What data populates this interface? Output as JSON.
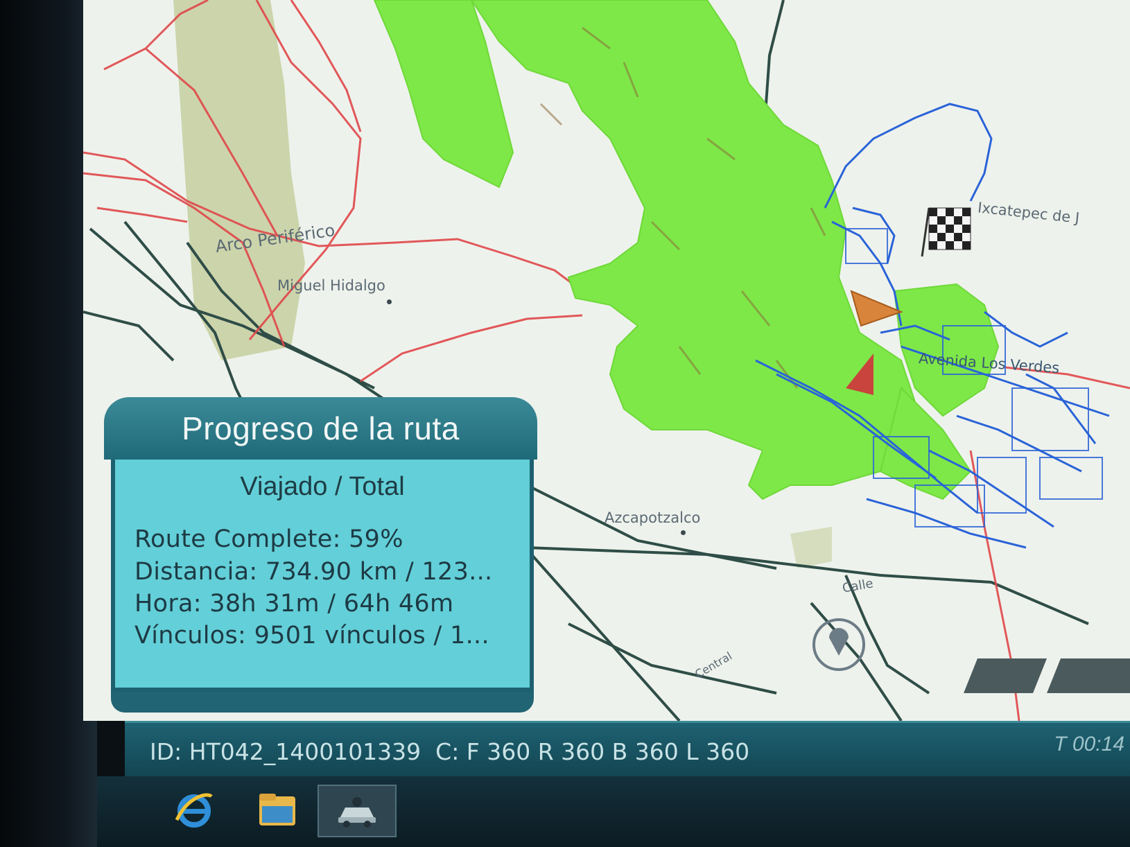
{
  "map": {
    "labels": {
      "arco_periferico": "Arco Periférico",
      "miguel_hidalgo": "Miguel Hidalgo",
      "azcapotzalco": "Azcapotzalco",
      "ixcatepec": "Ixcatepec de J",
      "avenida": "Avenida Los Verdes",
      "calle": "Calle",
      "central": "Central"
    },
    "colors": {
      "traveled_route": "#7ee848",
      "remaining_route": "#2a63d8",
      "highway": "#e0474a",
      "road": "#2f4d47",
      "park": "#c6cfa0"
    }
  },
  "route_panel": {
    "title": "Progreso de la ruta",
    "subtitle": "Viajado / Total",
    "route_complete": "Route Complete: 59%",
    "distance": "Distancia: 734.90 km / 123...",
    "time": "Hora: 38h 31m / 64h 46m",
    "links": "Vínculos: 9501 vínculos / 1..."
  },
  "status_bar": {
    "id_text": "ID: HT042_1400101339",
    "cameras": "C: F 360 R 360 B 360 L 360",
    "timer": "T 00:14"
  },
  "taskbar": {
    "icons": [
      "internet-explorer-icon",
      "file-explorer-icon",
      "route-app-icon"
    ]
  }
}
